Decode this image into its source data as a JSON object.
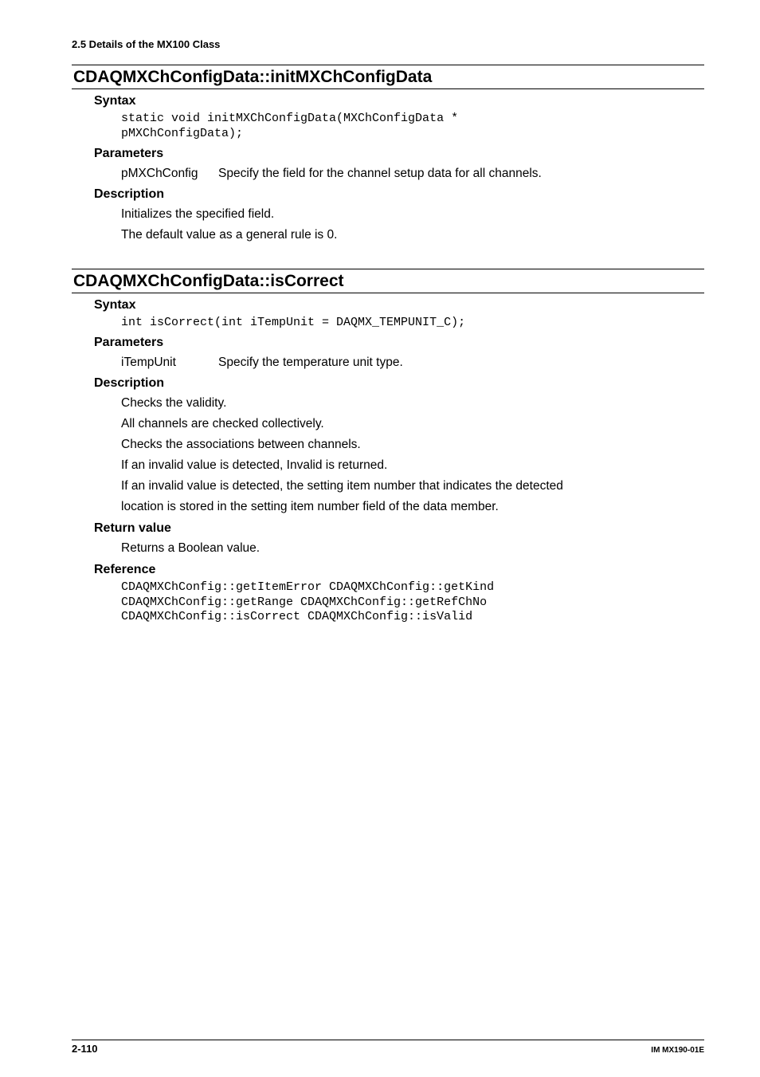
{
  "section_header": "2.5  Details of the MX100 Class",
  "func1": {
    "title": "CDAQMXChConfigData::initMXChConfigData",
    "syntax_label": "Syntax",
    "syntax_code": "static void initMXChConfigData(MXChConfigData *\npMXChConfigData);",
    "params_label": "Parameters",
    "param_name": "pMXChConfig",
    "param_desc": "Specify the field for the channel setup data for all channels.",
    "desc_label": "Description",
    "desc_line1": "Initializes the specified field.",
    "desc_line2": "The default value as a general rule is 0."
  },
  "func2": {
    "title": "CDAQMXChConfigData::isCorrect",
    "syntax_label": "Syntax",
    "syntax_code": "int isCorrect(int iTempUnit = DAQMX_TEMPUNIT_C);",
    "params_label": "Parameters",
    "param_name": "iTempUnit",
    "param_desc": "Specify the temperature unit type.",
    "desc_label": "Description",
    "desc_line1": "Checks the validity.",
    "desc_line2": "All channels are checked collectively.",
    "desc_line3": "Checks the associations between channels.",
    "desc_line4": "If an invalid value is detected, Invalid is returned.",
    "desc_line5": "If an invalid value is detected, the setting item number that indicates the detected",
    "desc_line6": "location is stored in the setting item number field of the data member.",
    "return_label": "Return value",
    "return_text": "Returns a Boolean value.",
    "ref_label": "Reference",
    "ref_code": "CDAQMXChConfig::getItemError CDAQMXChConfig::getKind\nCDAQMXChConfig::getRange CDAQMXChConfig::getRefChNo\nCDAQMXChConfig::isCorrect CDAQMXChConfig::isValid"
  },
  "footer": {
    "page": "2-110",
    "docid": "IM MX190-01E"
  }
}
